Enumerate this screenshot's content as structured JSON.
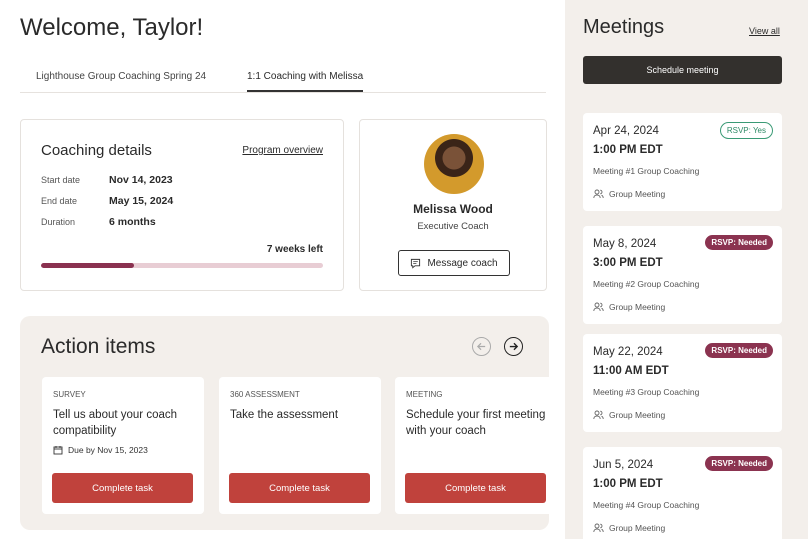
{
  "header": {
    "welcome": "Welcome, Taylor!"
  },
  "tabs": [
    {
      "label": "Lighthouse Group Coaching Spring 24"
    },
    {
      "label": "1:1 Coaching with Melissa"
    }
  ],
  "coaching_details": {
    "title": "Coaching details",
    "link": "Program overview",
    "rows": [
      {
        "label": "Start date",
        "value": "Nov 14, 2023"
      },
      {
        "label": "End date",
        "value": "May 15, 2024"
      },
      {
        "label": "Duration",
        "value": "6 months"
      }
    ],
    "remaining": "7 weeks left",
    "progress_percent": 33
  },
  "coach": {
    "name": "Melissa Wood",
    "role": "Executive Coach",
    "message_button": "Message coach"
  },
  "action_items": {
    "title": "Action items",
    "tasks": [
      {
        "kind": "SURVEY",
        "title": "Tell us about your coach compatibility",
        "due": "Due by Nov 15, 2023",
        "button": "Complete task"
      },
      {
        "kind": "360 ASSESSMENT",
        "title": "Take the assessment",
        "button": "Complete task"
      },
      {
        "kind": "MEETING",
        "title": "Schedule your first meeting with your coach",
        "button": "Complete task"
      }
    ]
  },
  "meetings": {
    "title": "Meetings",
    "view_all": "View all",
    "schedule_button": "Schedule meeting",
    "items": [
      {
        "date": "Apr 24, 2024",
        "time": "1:00 PM EDT",
        "title": "Meeting #1 Group Coaching",
        "type": "Group Meeting",
        "rsvp": "RSVP: Yes"
      },
      {
        "date": "May 8, 2024",
        "time": "3:00 PM EDT",
        "title": "Meeting #2 Group Coaching",
        "type": "Group Meeting",
        "rsvp": "RSVP: Needed"
      },
      {
        "date": "May 22, 2024",
        "time": "11:00 AM EDT",
        "title": "Meeting #3 Group Coaching",
        "type": "Group Meeting",
        "rsvp": "RSVP: Needed"
      },
      {
        "date": "Jun 5, 2024",
        "time": "1:00 PM EDT",
        "title": "Meeting #4 Group Coaching",
        "type": "Group Meeting",
        "rsvp": "RSVP: Needed"
      }
    ]
  },
  "colors": {
    "accent_red": "#c0423c",
    "rsvp_needed": "#8b3350",
    "rsvp_yes": "#3a9a75",
    "progress_fill": "#8a3150",
    "sidebar_bg": "#f3efeb"
  }
}
